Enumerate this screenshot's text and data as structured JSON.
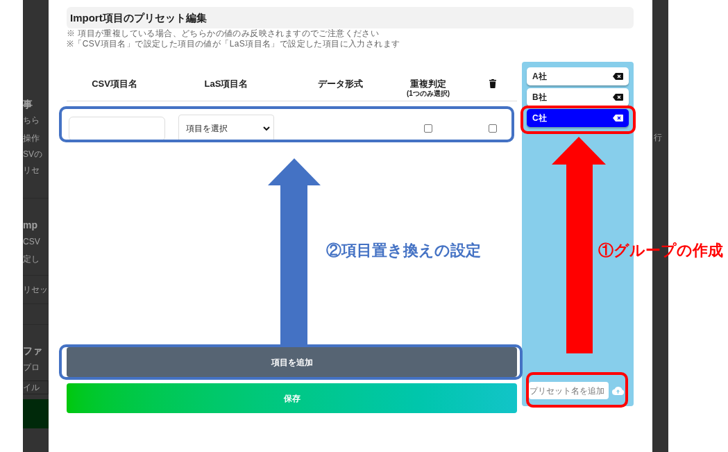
{
  "background_page": {
    "left": [
      {
        "kind": "heading",
        "text": "事"
      },
      {
        "kind": "text",
        "text": "ちら"
      },
      {
        "kind": "text",
        "text": "操作"
      },
      {
        "kind": "text",
        "text": "SVの"
      },
      {
        "kind": "text",
        "text": "リセ"
      },
      {
        "kind": "heading",
        "text": "mp"
      },
      {
        "kind": "text",
        "text": "CSV"
      },
      {
        "kind": "text",
        "text": "定し"
      },
      {
        "kind": "text",
        "text": "リセッ"
      },
      {
        "kind": "heading",
        "text": "ファ"
      },
      {
        "kind": "text",
        "text": "プロ"
      },
      {
        "kind": "file",
        "text": "イル"
      }
    ],
    "right": [
      {
        "kind": "text",
        "text": "行"
      }
    ]
  },
  "modal": {
    "title": "Import項目のプリセット編集",
    "notes": [
      "※ 項目が重複している場合、どちらかの値のみ反映されますのでご注意ください",
      "※「CSV項目名」で設定した項目の値が「LaS項目名」で設定した項目に入力されます"
    ],
    "columns": [
      {
        "label": "CSV項目名"
      },
      {
        "label": "LaS項目名"
      },
      {
        "label": "データ形式"
      },
      {
        "label": "重複判定",
        "sublabel": "(1つのみ選択)"
      }
    ],
    "rows": [
      {
        "las_item": "項目を選択",
        "duplicate_check": false,
        "delete_check": false
      }
    ],
    "add_button": "項目を追加",
    "save_button": "保存",
    "presets": {
      "items": [
        {
          "name": "A社",
          "selected": false
        },
        {
          "name": "B社",
          "selected": false
        },
        {
          "name": "C社",
          "selected": true
        }
      ],
      "new_name_placeholder": "プリセット名を追加"
    }
  },
  "callouts": [
    {
      "label": "②項目置き換えの設定",
      "color": "#4472c4"
    },
    {
      "label": "①グループの作成",
      "color": "#ff0000"
    }
  ]
}
